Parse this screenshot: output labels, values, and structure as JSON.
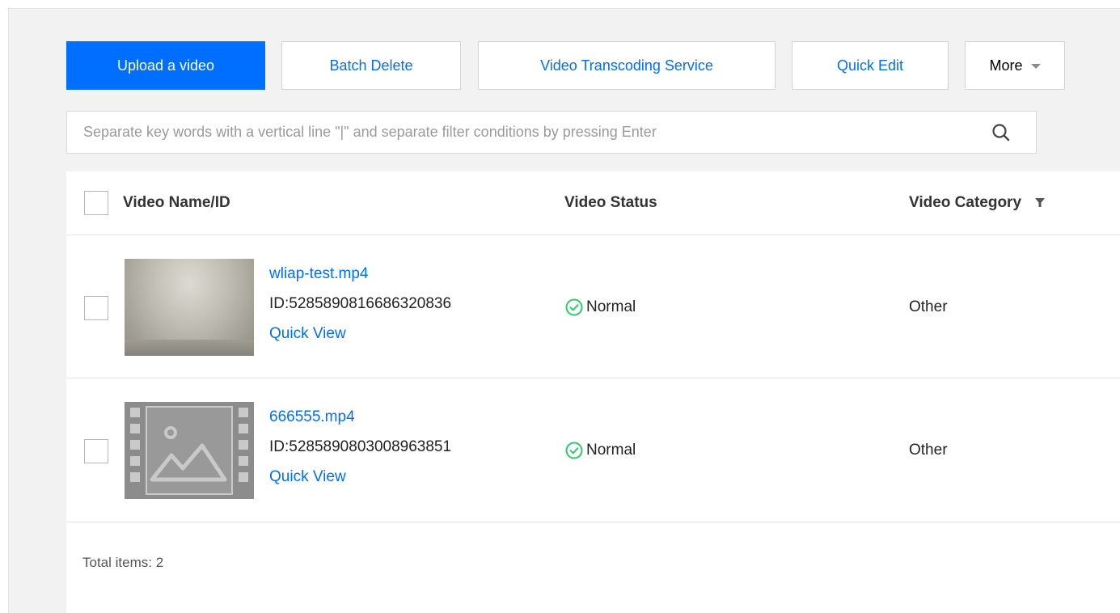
{
  "toolbar": {
    "upload": "Upload a video",
    "batch_delete": "Batch Delete",
    "transcoding": "Video Transcoding Service",
    "quick_edit": "Quick Edit",
    "more": "More"
  },
  "search": {
    "placeholder": "Separate key words with a vertical line \"|\" and separate filter conditions by pressing Enter"
  },
  "table": {
    "columns": {
      "name": "Video Name/ID",
      "status": "Video Status",
      "category": "Video Category"
    },
    "rows": [
      {
        "name": "wliap-test.mp4",
        "id": "ID:5285890816686320836",
        "quick_view": "Quick View",
        "status": "Normal",
        "category": "Other",
        "thumbnail": "video-frame"
      },
      {
        "name": "666555.mp4",
        "id": "ID:5285890803008963851",
        "quick_view": "Quick View",
        "status": "Normal",
        "category": "Other",
        "thumbnail": "image-placeholder-icon"
      }
    ],
    "total": "Total items:  2"
  },
  "colors": {
    "primary": "#006eff",
    "status_ok": "#29cc6a"
  }
}
